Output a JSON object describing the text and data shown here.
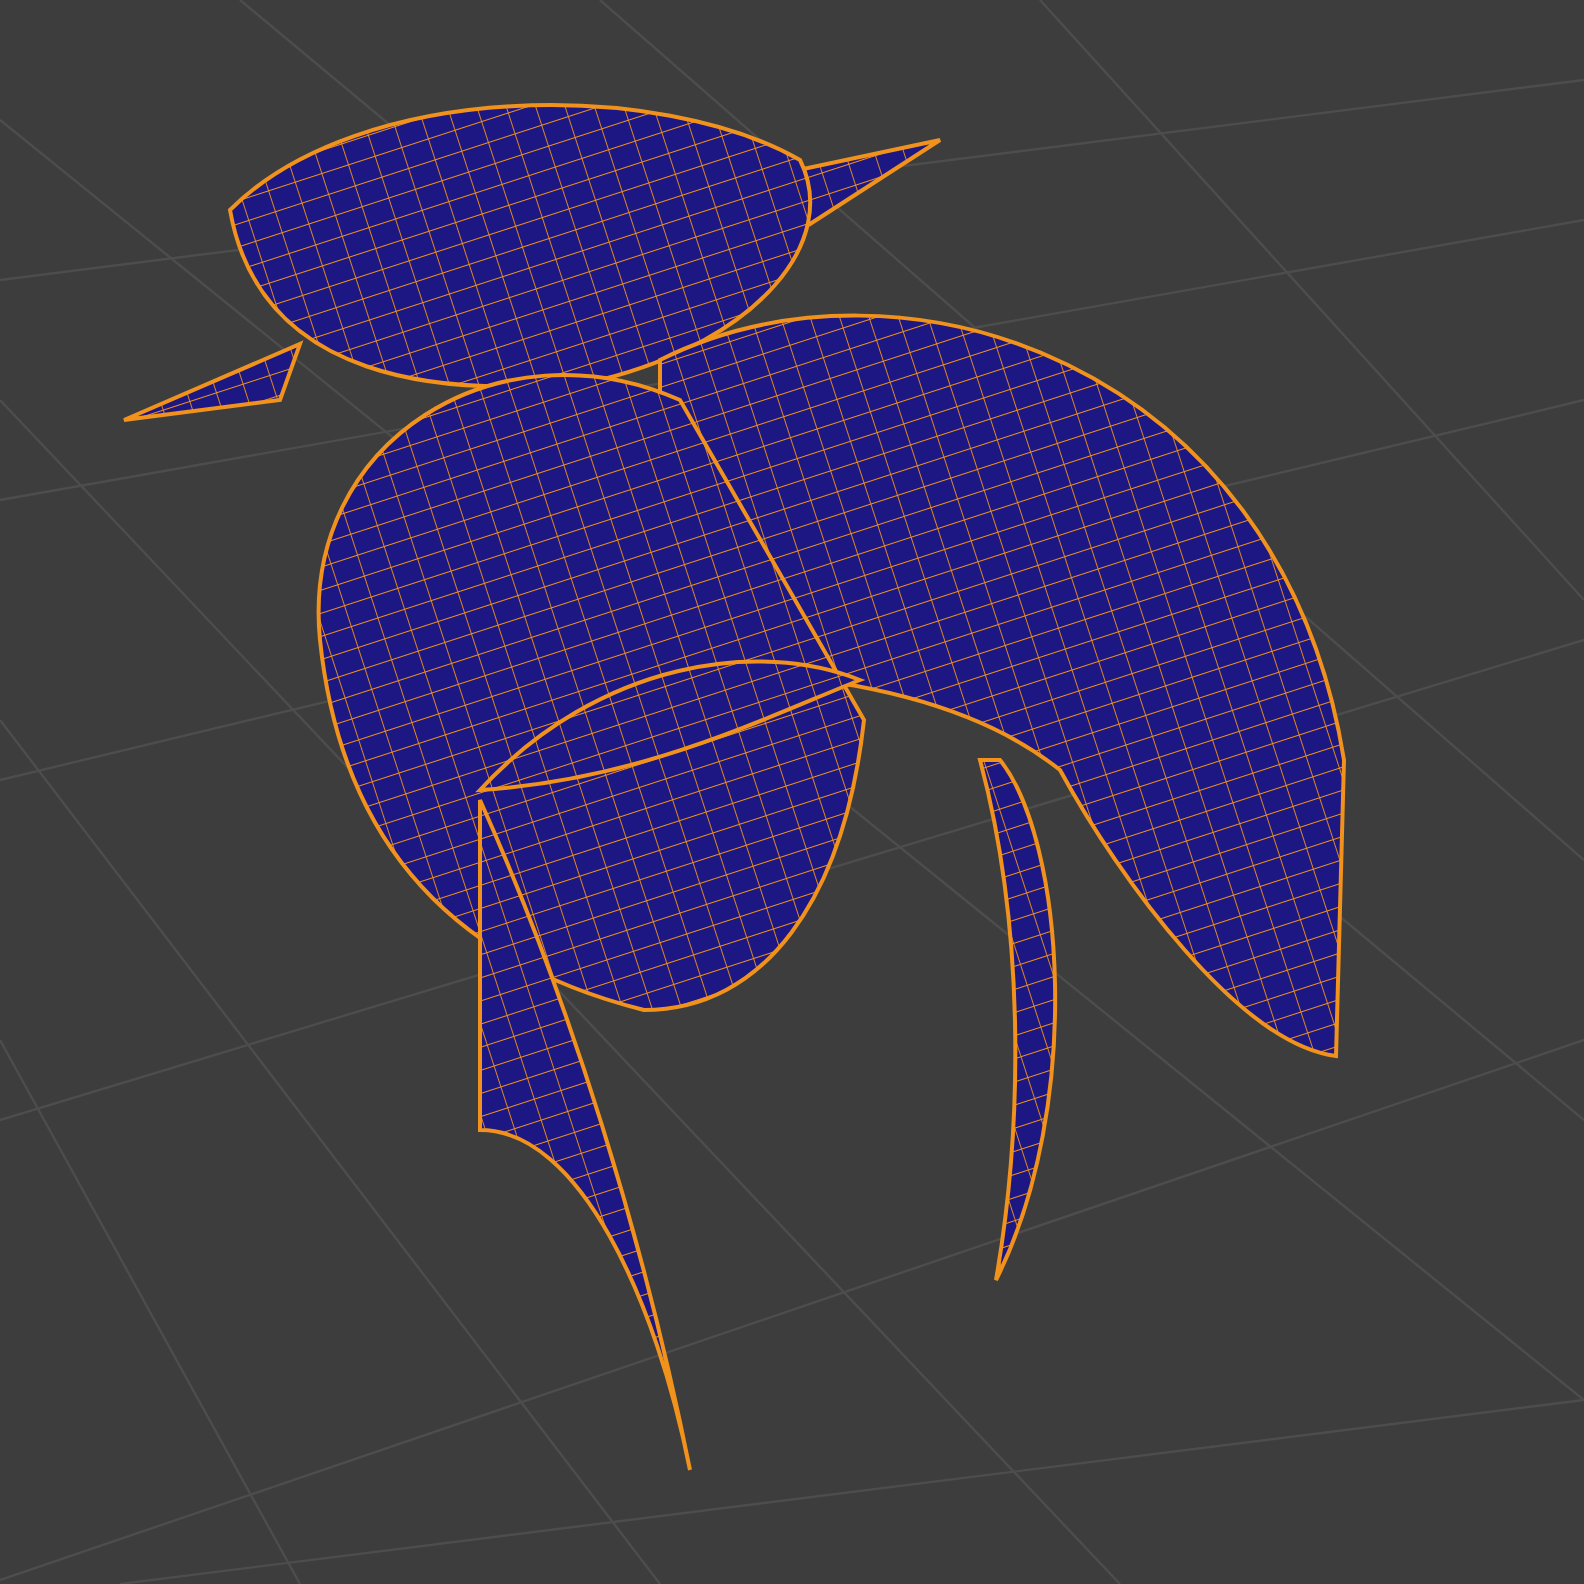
{
  "viewport": {
    "kind": "perspective",
    "mesh": {
      "selected": true
    }
  }
}
